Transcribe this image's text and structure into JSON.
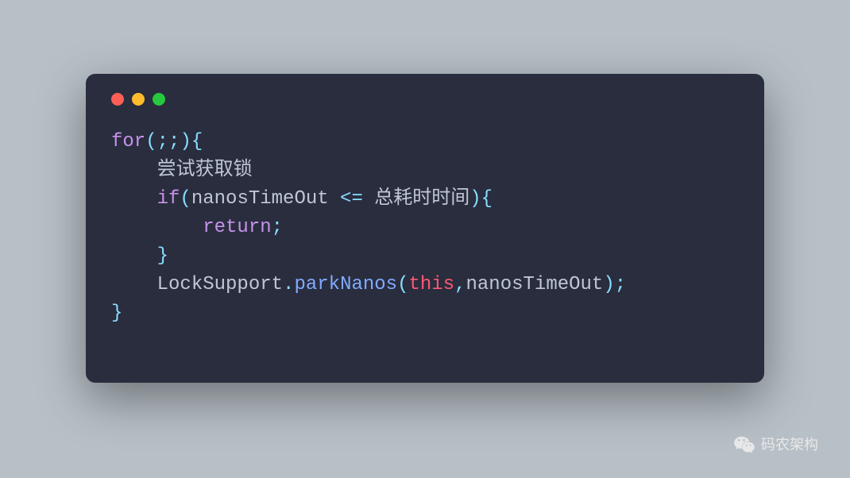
{
  "code": {
    "line1": {
      "for_kw": "for",
      "parens_open": "(",
      "semi1": ";",
      "semi2": ";",
      "parens_close": ")",
      "brace_open": "{"
    },
    "line2": {
      "comment": "尝试获取锁"
    },
    "line3": {
      "if_kw": "if",
      "parens_open": "(",
      "var1": "nanosTimeOut",
      "op": " <= ",
      "var2": "总耗时时间",
      "parens_close": ")",
      "brace_open": "{"
    },
    "line4": {
      "return_kw": "return",
      "semi": ";"
    },
    "line5": {
      "brace_close": "}"
    },
    "line6": {
      "class_name": "LockSupport",
      "dot": ".",
      "method": "parkNanos",
      "parens_open": "(",
      "this_kw": "this",
      "comma": ",",
      "arg": "nanosTimeOut",
      "parens_close": ")",
      "semi": ";"
    },
    "line7": {
      "brace_close": "}"
    }
  },
  "watermark": {
    "text": "码农架构"
  }
}
